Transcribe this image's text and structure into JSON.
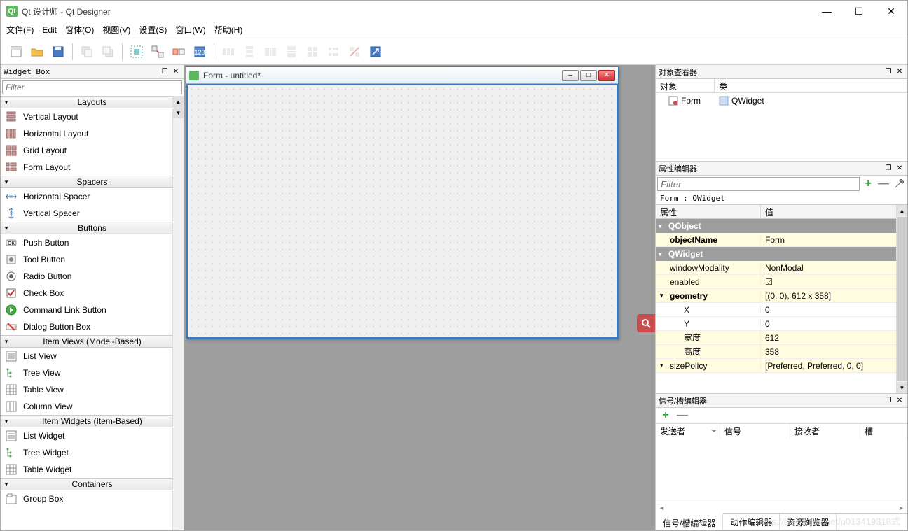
{
  "window": {
    "title": "Qt 设计师 - Qt Designer"
  },
  "menu": {
    "file": "文件(F)",
    "edit": "Edit",
    "form": "窗体(O)",
    "view": "视图(V)",
    "settings": "设置(S)",
    "window": "窗口(W)",
    "help": "帮助(H)"
  },
  "widgetbox": {
    "title": "Widget Box",
    "filter_placeholder": "Filter",
    "categories": [
      {
        "name": "Layouts",
        "items": [
          "Vertical Layout",
          "Horizontal Layout",
          "Grid Layout",
          "Form Layout"
        ]
      },
      {
        "name": "Spacers",
        "items": [
          "Horizontal Spacer",
          "Vertical Spacer"
        ]
      },
      {
        "name": "Buttons",
        "items": [
          "Push Button",
          "Tool Button",
          "Radio Button",
          "Check Box",
          "Command Link Button",
          "Dialog Button Box"
        ]
      },
      {
        "name": "Item Views (Model-Based)",
        "items": [
          "List View",
          "Tree View",
          "Table View",
          "Column View"
        ]
      },
      {
        "name": "Item Widgets (Item-Based)",
        "items": [
          "List Widget",
          "Tree Widget",
          "Table Widget"
        ]
      },
      {
        "name": "Containers",
        "items": [
          "Group Box"
        ]
      }
    ]
  },
  "form": {
    "title": "Form - untitled*"
  },
  "object_inspector": {
    "title": "对象查看器",
    "col_object": "对象",
    "col_class": "类",
    "row_object": "Form",
    "row_class": "QWidget"
  },
  "property_editor": {
    "title": "属性编辑器",
    "filter_placeholder": "Filter",
    "context": "Form : QWidget",
    "col_prop": "属性",
    "col_val": "值",
    "groups": [
      {
        "name": "QObject",
        "rows": [
          {
            "name": "objectName",
            "value": "Form",
            "bold": true,
            "yellow": true
          }
        ]
      },
      {
        "name": "QWidget",
        "rows": [
          {
            "name": "windowModality",
            "value": "NonModal",
            "yellow": true
          },
          {
            "name": "enabled",
            "value": "☑",
            "yellow": true
          },
          {
            "name": "geometry",
            "value": "[(0, 0), 612 x 358]",
            "bold": true,
            "yellow": true,
            "expandable": true
          },
          {
            "name": "X",
            "value": "0",
            "indent": true,
            "yellow": false
          },
          {
            "name": "Y",
            "value": "0",
            "indent": true,
            "yellow": false
          },
          {
            "name": "宽度",
            "value": "612",
            "indent": true,
            "yellow": true
          },
          {
            "name": "高度",
            "value": "358",
            "indent": true,
            "yellow": true
          },
          {
            "name": "sizePolicy",
            "value": "[Preferred, Preferred, 0, 0]",
            "yellow": true,
            "expandable": true
          }
        ]
      }
    ]
  },
  "signal_editor": {
    "title": "信号/槽编辑器",
    "col_sender": "发送者",
    "col_signal": "信号",
    "col_receiver": "接收者",
    "col_slot": "槽"
  },
  "bottom_tabs": {
    "t1": "信号/槽编辑器",
    "t2": "动作编辑器",
    "t3": "资源浏览器"
  },
  "watermark": "https://blog.csdn.net/u013419318式"
}
